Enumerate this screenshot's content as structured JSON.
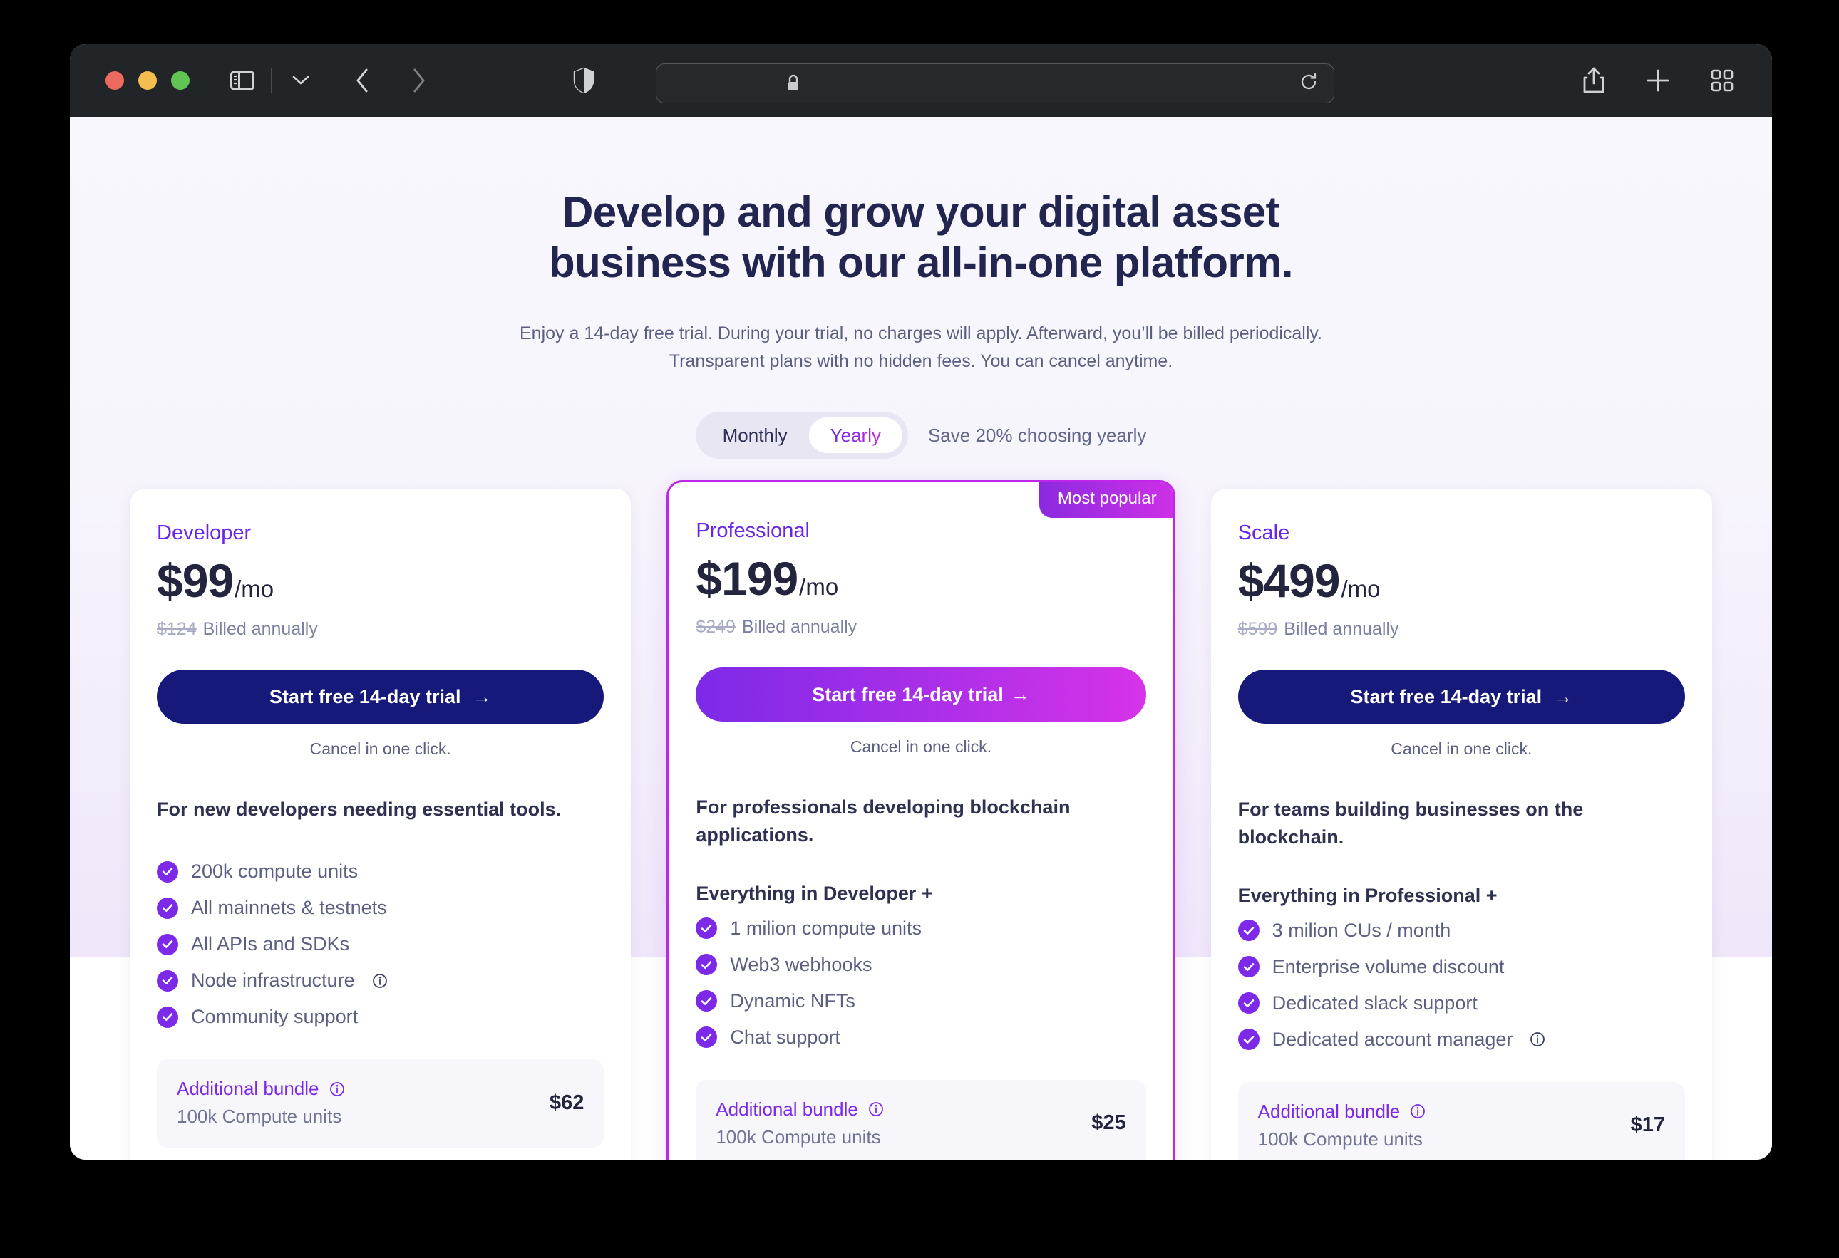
{
  "browser": {
    "traffic_lights": [
      "close",
      "minimize",
      "maximize"
    ],
    "sidebar_toggle": "sidebar-icon",
    "tab_group_chevron": "chevron-down-icon",
    "back": "chevron-left-icon",
    "forward": "chevron-right-icon",
    "shield": "shield-icon",
    "url_value": "",
    "url_placeholder": "",
    "lock": "lock-icon",
    "reload": "reload-icon",
    "share": "share-icon",
    "new_tab": "plus-icon",
    "tab_overview": "grid-icon"
  },
  "hero": {
    "headline_line1": "Develop and grow your digital asset",
    "headline_line2": "business with our all-in-one platform.",
    "subhead_line1": "Enjoy a 14-day free trial. During your trial, no charges will apply. Afterward, you’ll be",
    "subhead_line2": "billed periodically. Transparent plans with no hidden fees. You can cancel anytime."
  },
  "billing_toggle": {
    "monthly_label": "Monthly",
    "yearly_label": "Yearly",
    "selected": "Yearly",
    "save_note": "Save 20% choosing yearly"
  },
  "colors": {
    "accent_purple": "#7C2AE8",
    "accent_magenta": "#D633E8",
    "plan_name": "#6925E8",
    "cta_navy": "#17197A",
    "featured_border": "#C026E8",
    "headline": "#222550"
  },
  "plans": [
    {
      "name": "Developer",
      "price": "$99",
      "per": "/mo",
      "old_price": "$124",
      "billed_note": "Billed annually",
      "cta_label": "Start free 14-day trial",
      "cta_arrow": "→",
      "cancel_note": "Cancel in one click.",
      "description": "For new developers needing essential tools.",
      "everything_header": "",
      "features": [
        {
          "label": "200k compute units",
          "info": false
        },
        {
          "label": "All mainnets & testnets",
          "info": false
        },
        {
          "label": "All APIs and SDKs",
          "info": false
        },
        {
          "label": "Node infrastructure",
          "info": true
        },
        {
          "label": "Community support",
          "info": false
        }
      ],
      "bundle": {
        "title": "Additional bundle",
        "subtitle": "100k Compute units",
        "price": "$62",
        "info": true
      },
      "featured": false,
      "badge": ""
    },
    {
      "name": "Professional",
      "price": "$199",
      "per": "/mo",
      "old_price": "$249",
      "billed_note": "Billed annually",
      "cta_label": "Start free 14-day trial",
      "cta_arrow": "→",
      "cancel_note": "Cancel in one click.",
      "description": "For professionals developing blockchain applications.",
      "everything_header": "Everything in Developer +",
      "features": [
        {
          "label": "1 milion compute units",
          "info": false
        },
        {
          "label": "Web3 webhooks",
          "info": false
        },
        {
          "label": "Dynamic NFTs",
          "info": false
        },
        {
          "label": "Chat support",
          "info": false
        }
      ],
      "bundle": {
        "title": "Additional bundle",
        "subtitle": "100k Compute units",
        "price": "$25",
        "info": true
      },
      "featured": true,
      "badge": "Most popular"
    },
    {
      "name": "Scale",
      "price": "$499",
      "per": "/mo",
      "old_price": "$599",
      "billed_note": "Billed annually",
      "cta_label": "Start free 14-day trial",
      "cta_arrow": "→",
      "cancel_note": "Cancel in one click.",
      "description": "For teams building businesses on the blockchain.",
      "everything_header": "Everything in Professional +",
      "features": [
        {
          "label": "3 milion CUs / month",
          "info": false
        },
        {
          "label": "Enterprise volume discount",
          "info": false
        },
        {
          "label": "Dedicated slack support",
          "info": false
        },
        {
          "label": "Dedicated account manager",
          "info": true
        }
      ],
      "bundle": {
        "title": "Additional bundle",
        "subtitle": "100k Compute units",
        "price": "$17",
        "info": true
      },
      "featured": false,
      "badge": ""
    }
  ]
}
